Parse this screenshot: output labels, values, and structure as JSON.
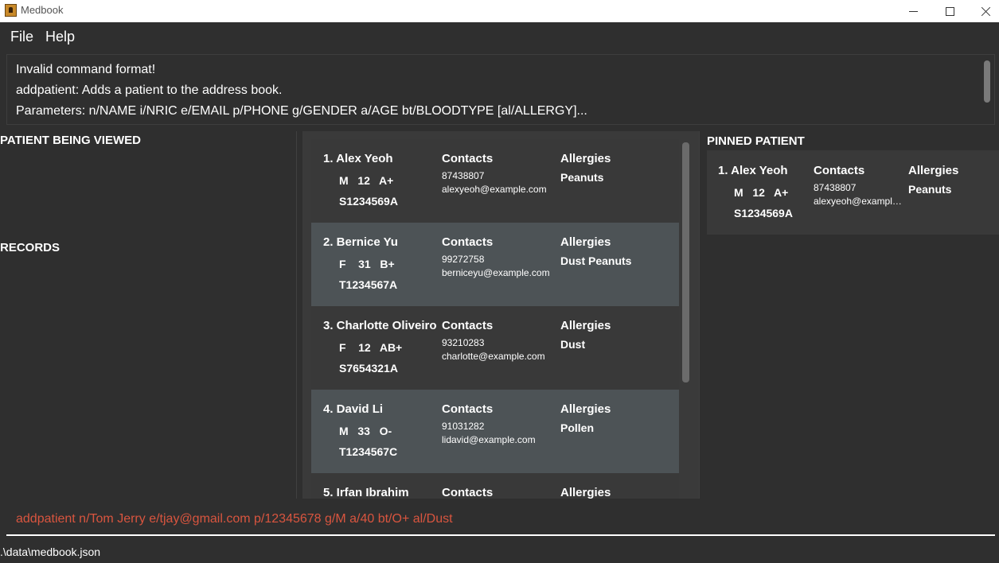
{
  "window": {
    "title": "Medbook",
    "icon": "medbook-app-icon"
  },
  "menu": {
    "file": "File",
    "help": "Help"
  },
  "result": {
    "line1": "Invalid command format!",
    "line2": "addpatient: Adds a patient to the address book.",
    "line3": "Parameters: n/NAME i/NRIC e/EMAIL p/PHONE g/GENDER a/AGE bt/BLOODTYPE [al/ALLERGY]..."
  },
  "left": {
    "viewed_heading": "PATIENT BEING VIEWED",
    "records_heading": "RECORDS"
  },
  "patients": [
    {
      "name": "1. Alex Yeoh",
      "meta": "M   12   A+",
      "nric": "S1234569A",
      "contacts_label": "Contacts",
      "phone": "87438807",
      "email": "alexyeoh@example.com",
      "allergies_label": "Allergies",
      "allergies": "Peanuts"
    },
    {
      "name": "2. Bernice Yu",
      "meta": "F    31   B+",
      "nric": "T1234567A",
      "contacts_label": "Contacts",
      "phone": "99272758",
      "email": "berniceyu@example.com",
      "allergies_label": "Allergies",
      "allergies": "Dust Peanuts"
    },
    {
      "name": "3. Charlotte Oliveiro",
      "meta": "F    12   AB+",
      "nric": "S7654321A",
      "contacts_label": "Contacts",
      "phone": "93210283",
      "email": "charlotte@example.com",
      "allergies_label": "Allergies",
      "allergies": "Dust"
    },
    {
      "name": "4. David Li",
      "meta": "M   33   O-",
      "nric": "T1234567C",
      "contacts_label": "Contacts",
      "phone": "91031282",
      "email": "lidavid@example.com",
      "allergies_label": "Allergies",
      "allergies": "Pollen"
    },
    {
      "name": "5. Irfan Ibrahim",
      "meta": "",
      "nric": "",
      "contacts_label": "Contacts",
      "phone": "",
      "email": "",
      "allergies_label": "Allergies",
      "allergies": ""
    }
  ],
  "pinned": {
    "heading": "PINNED PATIENT",
    "name": "1. Alex Yeoh",
    "meta": "M   12   A+",
    "nric": "S1234569A",
    "contacts_label": "Contacts",
    "phone": "87438807",
    "email": "alexyeoh@example.com",
    "allergies_label": "Allergies",
    "allergies": "Peanuts"
  },
  "command": {
    "value": "addpatient n/Tom Jerry e/tjay@gmail.com p/12345678 g/M a/40 bt/O+ al/Dust"
  },
  "status": {
    "path": ".\\data\\medbook.json"
  }
}
